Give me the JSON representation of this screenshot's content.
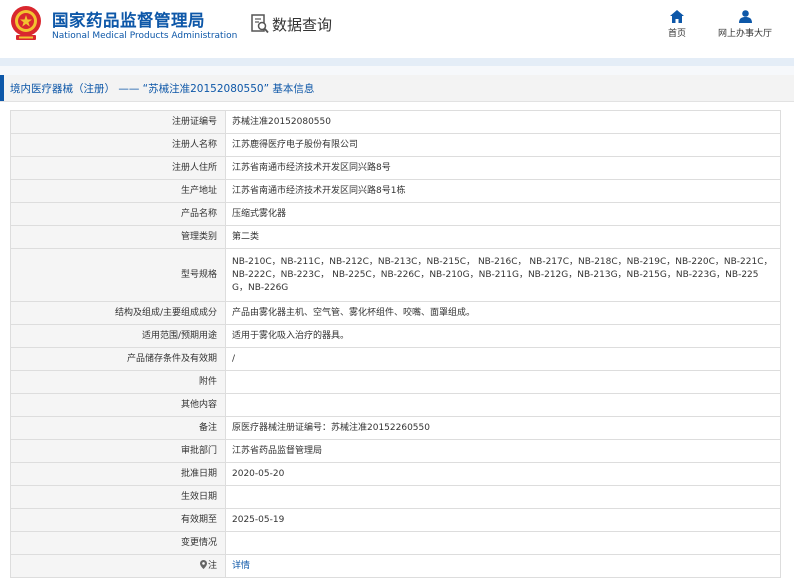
{
  "header": {
    "site_title": "国家药品监督管理局",
    "site_subtitle": "National Medical Products Administration",
    "search_title": "数据查询",
    "nav": {
      "home": "首页",
      "hall": "网上办事大厅"
    }
  },
  "page": {
    "heading": "境内医疗器械（注册） —— “苏械注准20152080550” 基本信息"
  },
  "details": [
    {
      "label": "注册证编号",
      "value": "苏械注准20152080550"
    },
    {
      "label": "注册人名称",
      "value": "江苏鹿得医疗电子股份有限公司"
    },
    {
      "label": "注册人住所",
      "value": "江苏省南通市经济技术开发区同兴路8号"
    },
    {
      "label": "生产地址",
      "value": "江苏省南通市经济技术开发区同兴路8号1栋"
    },
    {
      "label": "产品名称",
      "value": "压缩式雾化器"
    },
    {
      "label": "管理类别",
      "value": "第二类"
    },
    {
      "label": "型号规格",
      "value": "NB-210C，NB-211C，NB-212C，NB-213C，NB-215C， NB-216C， NB-217C，NB-218C，NB-219C，NB-220C，NB-221C，NB-222C，NB-223C， NB-225C，NB-226C，NB-210G，NB-211G，NB-212G，NB-213G，NB-215G，NB-223G，NB-225G，NB-226G"
    },
    {
      "label": "结构及组成/主要组成成分",
      "value": "产品由雾化器主机、空气管、雾化杯组件、咬嘴、面罩组成。"
    },
    {
      "label": "适用范围/预期用途",
      "value": "适用于雾化吸入治疗的器具。"
    },
    {
      "label": "产品储存条件及有效期",
      "value": "/"
    },
    {
      "label": "附件",
      "value": ""
    },
    {
      "label": "其他内容",
      "value": ""
    },
    {
      "label": "备注",
      "value": "原医疗器械注册证编号：苏械注准20152260550"
    },
    {
      "label": "审批部门",
      "value": "江苏省药品监督管理局"
    },
    {
      "label": "批准日期",
      "value": "2020-05-20"
    },
    {
      "label": "生效日期",
      "value": ""
    },
    {
      "label": "有效期至",
      "value": "2025-05-19"
    },
    {
      "label": "变更情况",
      "value": ""
    },
    {
      "label": "注",
      "value": "详情"
    }
  ]
}
